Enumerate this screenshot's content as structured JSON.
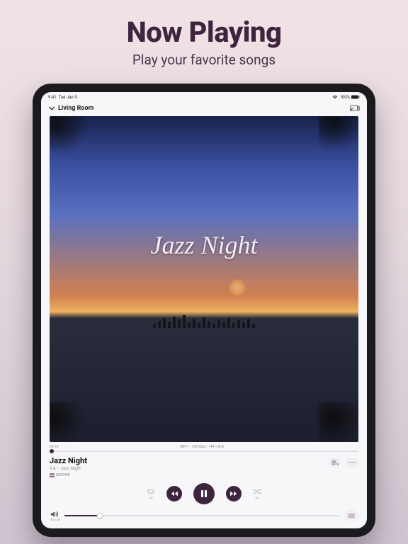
{
  "hero": {
    "title": "Now Playing",
    "subtitle": "Play your favorite songs"
  },
  "statusbar": {
    "time": "9:41",
    "date": "Tue Jan 9",
    "battery": "100%"
  },
  "header": {
    "room": "Living Room"
  },
  "artwork": {
    "overlay_text": "Jazz Night"
  },
  "progress": {
    "elapsed": "00:10",
    "format": "MP3 – 192 kbps – 44.1 kHz"
  },
  "track": {
    "title": "Jazz Night",
    "artist_album": "V.A – Jazz Night",
    "source": "SERVER"
  },
  "transport": {
    "repeat_label": "Off",
    "shuffle_label": "Off"
  },
  "volume": {
    "db": "-45.0 dB"
  }
}
